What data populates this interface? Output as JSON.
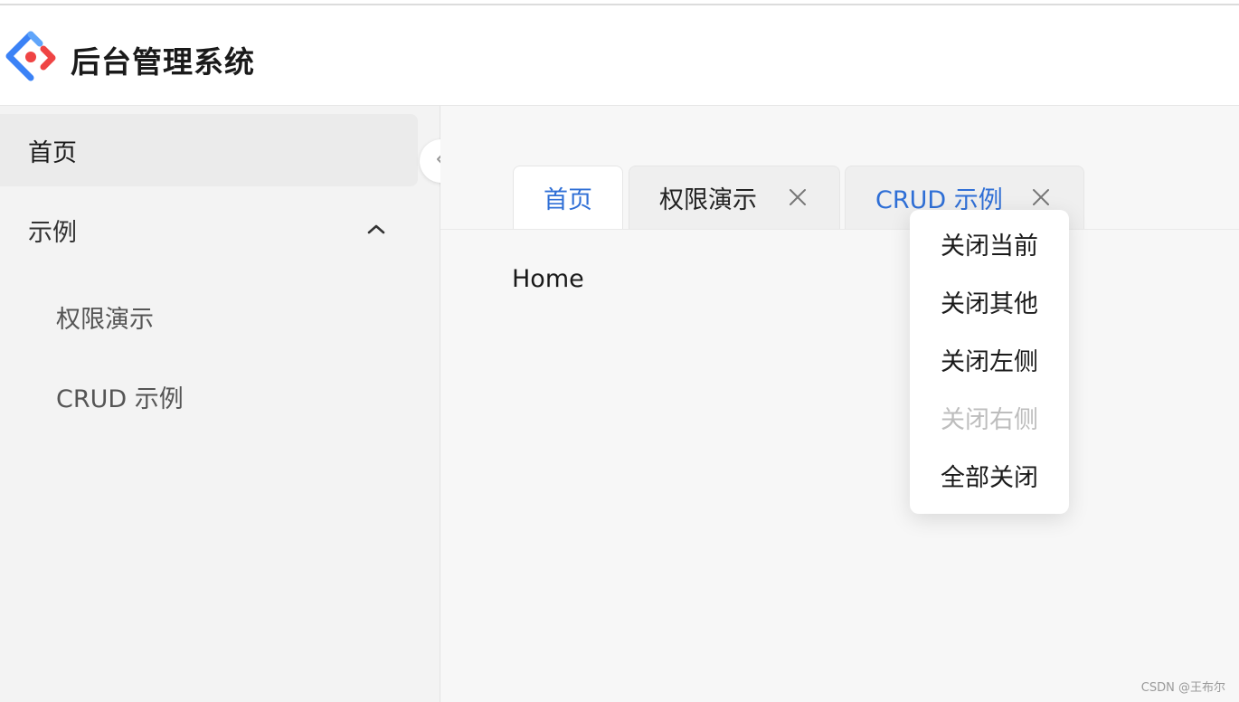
{
  "app": {
    "title": "后台管理系统"
  },
  "sidebar": {
    "items": [
      {
        "label": "首页",
        "active": true
      },
      {
        "label": "示例",
        "expanded": true
      },
      {
        "label": "权限演示"
      },
      {
        "label": "CRUD 示例"
      }
    ]
  },
  "tabs": [
    {
      "label": "首页",
      "active": true,
      "closable": false
    },
    {
      "label": "权限演示",
      "active": false,
      "closable": true
    },
    {
      "label": "CRUD 示例",
      "active": false,
      "closable": true
    }
  ],
  "content": {
    "text": "Home"
  },
  "context_menu": {
    "items": [
      {
        "label": "关闭当前",
        "disabled": false
      },
      {
        "label": "关闭其他",
        "disabled": false
      },
      {
        "label": "关闭左侧",
        "disabled": false
      },
      {
        "label": "关闭右侧",
        "disabled": true
      },
      {
        "label": "全部关闭",
        "disabled": false
      }
    ]
  },
  "watermark": "CSDN @王布尔",
  "colors": {
    "accent": "#2f6fd6",
    "logo_blue": "#3b82f6",
    "logo_red": "#ef4444",
    "disabled": "#bdbdbd"
  },
  "icons": [
    "logo-icon",
    "chevron-up-icon",
    "chevron-left-icon",
    "close-icon"
  ]
}
